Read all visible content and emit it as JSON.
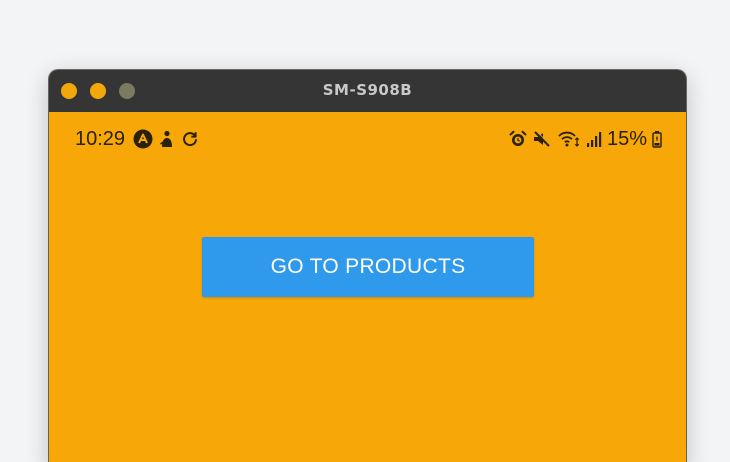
{
  "window": {
    "title": "SM-S908B"
  },
  "status_bar": {
    "time": "10:29",
    "left_icons": [
      "app-a-icon",
      "notification-person-icon",
      "sync-icon"
    ],
    "right_icons": [
      "alarm-icon",
      "mute-icon",
      "wifi-icon",
      "signal-icon",
      "battery-icon"
    ],
    "battery_percent": "15%"
  },
  "main": {
    "button_label": "GO TO PRODUCTS"
  },
  "colors": {
    "background": "#f7a707",
    "button": "#2f9aec",
    "titlebar": "#353535"
  }
}
